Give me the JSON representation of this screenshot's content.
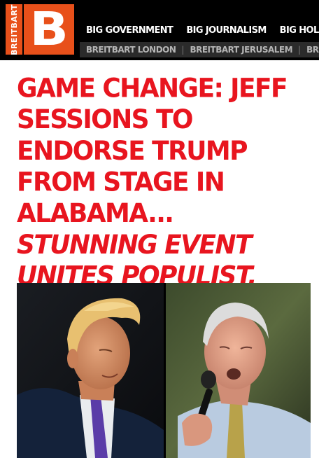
{
  "site": {
    "logo_side_text": "BREITBART",
    "logo_letter": "B",
    "logo_color": "#e8501a"
  },
  "nav_primary": [
    {
      "label": "BIG GOVERNMENT"
    },
    {
      "label": "BIG JOURNALISM"
    },
    {
      "label": "BIG HOLLYWOOD"
    }
  ],
  "nav_secondary": [
    {
      "label": "BREITBART LONDON"
    },
    {
      "label": "BREITBART JERUSALEM"
    },
    {
      "label": "BREITBART"
    }
  ],
  "article": {
    "headline_main": "GAME CHANGE: JEFF SESSIONS TO ENDORSE TRUMP FROM STAGE IN ALABAMA...",
    "headline_italic": "STUNNING EVENT UNITES POPULIST, NATIONALIST MOVEMENT",
    "headline_color": "#e8151f"
  }
}
